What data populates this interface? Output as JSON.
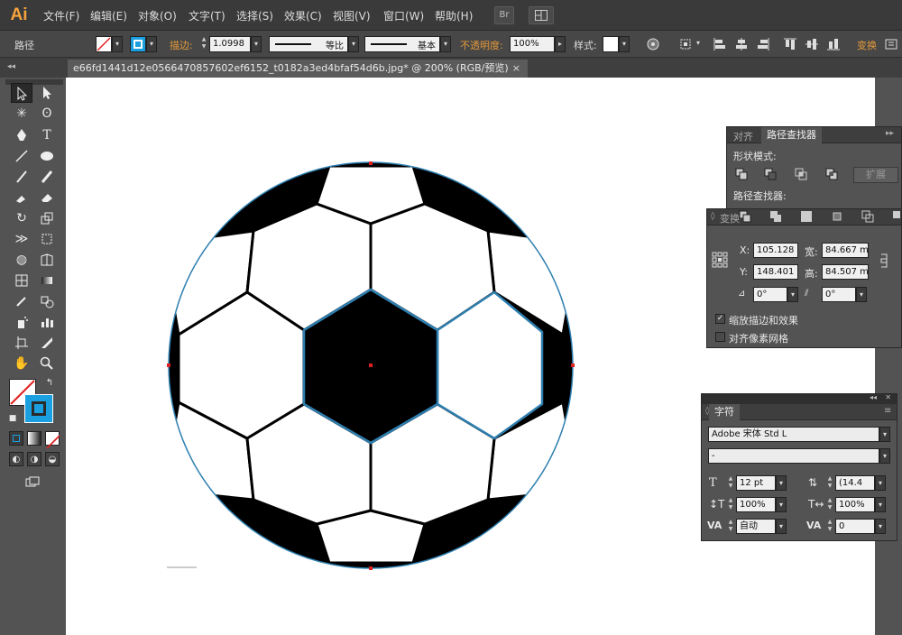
{
  "app": {
    "logo": "Ai"
  },
  "menu": [
    "文件(F)",
    "编辑(E)",
    "对象(O)",
    "文字(T)",
    "选择(S)",
    "效果(C)",
    "视图(V)",
    "窗口(W)",
    "帮助(H)"
  ],
  "menu_buttons": {
    "bridge": "Br"
  },
  "control": {
    "object_type": "路径",
    "stroke_label": "描边:",
    "stroke_weight": "1.0998",
    "profile_label": "等比",
    "brush_label": "基本",
    "opacity_label": "不透明度:",
    "opacity_value": "100%",
    "style_label": "样式:",
    "transform_label": "变换"
  },
  "document": {
    "tab_title": "e66fd1441d12e0566470857602ef6152_t0182a3ed4bfaf54d6b.jpg*  @  200% (RGB/预览)",
    "close": "×"
  },
  "pathfinder_panel": {
    "tabs": [
      "对齐",
      "路径查找器"
    ],
    "shape_modes_label": "形状模式:",
    "expand_button": "扩展",
    "pathfinders_label": "路径查找器:",
    "menu_glyph": "▸▸"
  },
  "transform_panel": {
    "title": "变换",
    "x_label": "X:",
    "x_value": "105.128",
    "w_label": "宽:",
    "w_value": "84.667 m",
    "y_label": "Y:",
    "y_value": "148.401",
    "h_label": "高:",
    "h_value": "84.507 m",
    "rotate_value": "0°",
    "shear_value": "0°",
    "scale_strokes_label": "缩放描边和效果",
    "scale_strokes_checked": true,
    "align_pixel_label": "对齐像素网格",
    "align_pixel_checked": false
  },
  "character_panel": {
    "title": "字符",
    "font_family": "Adobe 宋体 Std L",
    "font_style": "-",
    "font_size": "12 pt",
    "leading": "(14.4",
    "vertical_scale": "100%",
    "horizontal_scale": "100%",
    "kerning": "自动",
    "tracking": "0"
  },
  "colors": {
    "accent_blue": "#1aa0e0",
    "path_blue": "#2e7fb0",
    "anchor_red": "#e02020",
    "logo_orange": "#f7a33d"
  }
}
